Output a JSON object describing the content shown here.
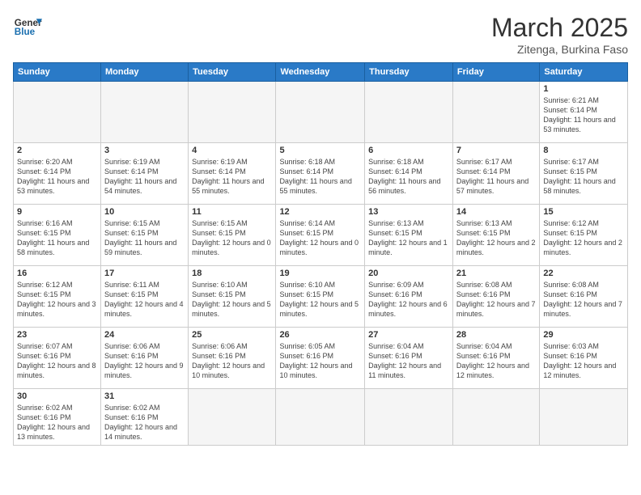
{
  "logo": {
    "text_general": "General",
    "text_blue": "Blue"
  },
  "title": "March 2025",
  "subtitle": "Zitenga, Burkina Faso",
  "days_of_week": [
    "Sunday",
    "Monday",
    "Tuesday",
    "Wednesday",
    "Thursday",
    "Friday",
    "Saturday"
  ],
  "weeks": [
    [
      {
        "day": "",
        "info": ""
      },
      {
        "day": "",
        "info": ""
      },
      {
        "day": "",
        "info": ""
      },
      {
        "day": "",
        "info": ""
      },
      {
        "day": "",
        "info": ""
      },
      {
        "day": "",
        "info": ""
      },
      {
        "day": "1",
        "info": "Sunrise: 6:21 AM\nSunset: 6:14 PM\nDaylight: 11 hours and 53 minutes."
      }
    ],
    [
      {
        "day": "2",
        "info": "Sunrise: 6:20 AM\nSunset: 6:14 PM\nDaylight: 11 hours and 53 minutes."
      },
      {
        "day": "3",
        "info": "Sunrise: 6:19 AM\nSunset: 6:14 PM\nDaylight: 11 hours and 54 minutes."
      },
      {
        "day": "4",
        "info": "Sunrise: 6:19 AM\nSunset: 6:14 PM\nDaylight: 11 hours and 55 minutes."
      },
      {
        "day": "5",
        "info": "Sunrise: 6:18 AM\nSunset: 6:14 PM\nDaylight: 11 hours and 55 minutes."
      },
      {
        "day": "6",
        "info": "Sunrise: 6:18 AM\nSunset: 6:14 PM\nDaylight: 11 hours and 56 minutes."
      },
      {
        "day": "7",
        "info": "Sunrise: 6:17 AM\nSunset: 6:14 PM\nDaylight: 11 hours and 57 minutes."
      },
      {
        "day": "8",
        "info": "Sunrise: 6:17 AM\nSunset: 6:15 PM\nDaylight: 11 hours and 58 minutes."
      }
    ],
    [
      {
        "day": "9",
        "info": "Sunrise: 6:16 AM\nSunset: 6:15 PM\nDaylight: 11 hours and 58 minutes."
      },
      {
        "day": "10",
        "info": "Sunrise: 6:15 AM\nSunset: 6:15 PM\nDaylight: 11 hours and 59 minutes."
      },
      {
        "day": "11",
        "info": "Sunrise: 6:15 AM\nSunset: 6:15 PM\nDaylight: 12 hours and 0 minutes."
      },
      {
        "day": "12",
        "info": "Sunrise: 6:14 AM\nSunset: 6:15 PM\nDaylight: 12 hours and 0 minutes."
      },
      {
        "day": "13",
        "info": "Sunrise: 6:13 AM\nSunset: 6:15 PM\nDaylight: 12 hours and 1 minute."
      },
      {
        "day": "14",
        "info": "Sunrise: 6:13 AM\nSunset: 6:15 PM\nDaylight: 12 hours and 2 minutes."
      },
      {
        "day": "15",
        "info": "Sunrise: 6:12 AM\nSunset: 6:15 PM\nDaylight: 12 hours and 2 minutes."
      }
    ],
    [
      {
        "day": "16",
        "info": "Sunrise: 6:12 AM\nSunset: 6:15 PM\nDaylight: 12 hours and 3 minutes."
      },
      {
        "day": "17",
        "info": "Sunrise: 6:11 AM\nSunset: 6:15 PM\nDaylight: 12 hours and 4 minutes."
      },
      {
        "day": "18",
        "info": "Sunrise: 6:10 AM\nSunset: 6:15 PM\nDaylight: 12 hours and 5 minutes."
      },
      {
        "day": "19",
        "info": "Sunrise: 6:10 AM\nSunset: 6:15 PM\nDaylight: 12 hours and 5 minutes."
      },
      {
        "day": "20",
        "info": "Sunrise: 6:09 AM\nSunset: 6:16 PM\nDaylight: 12 hours and 6 minutes."
      },
      {
        "day": "21",
        "info": "Sunrise: 6:08 AM\nSunset: 6:16 PM\nDaylight: 12 hours and 7 minutes."
      },
      {
        "day": "22",
        "info": "Sunrise: 6:08 AM\nSunset: 6:16 PM\nDaylight: 12 hours and 7 minutes."
      }
    ],
    [
      {
        "day": "23",
        "info": "Sunrise: 6:07 AM\nSunset: 6:16 PM\nDaylight: 12 hours and 8 minutes."
      },
      {
        "day": "24",
        "info": "Sunrise: 6:06 AM\nSunset: 6:16 PM\nDaylight: 12 hours and 9 minutes."
      },
      {
        "day": "25",
        "info": "Sunrise: 6:06 AM\nSunset: 6:16 PM\nDaylight: 12 hours and 10 minutes."
      },
      {
        "day": "26",
        "info": "Sunrise: 6:05 AM\nSunset: 6:16 PM\nDaylight: 12 hours and 10 minutes."
      },
      {
        "day": "27",
        "info": "Sunrise: 6:04 AM\nSunset: 6:16 PM\nDaylight: 12 hours and 11 minutes."
      },
      {
        "day": "28",
        "info": "Sunrise: 6:04 AM\nSunset: 6:16 PM\nDaylight: 12 hours and 12 minutes."
      },
      {
        "day": "29",
        "info": "Sunrise: 6:03 AM\nSunset: 6:16 PM\nDaylight: 12 hours and 12 minutes."
      }
    ],
    [
      {
        "day": "30",
        "info": "Sunrise: 6:02 AM\nSunset: 6:16 PM\nDaylight: 12 hours and 13 minutes."
      },
      {
        "day": "31",
        "info": "Sunrise: 6:02 AM\nSunset: 6:16 PM\nDaylight: 12 hours and 14 minutes."
      },
      {
        "day": "",
        "info": ""
      },
      {
        "day": "",
        "info": ""
      },
      {
        "day": "",
        "info": ""
      },
      {
        "day": "",
        "info": ""
      },
      {
        "day": "",
        "info": ""
      }
    ]
  ]
}
